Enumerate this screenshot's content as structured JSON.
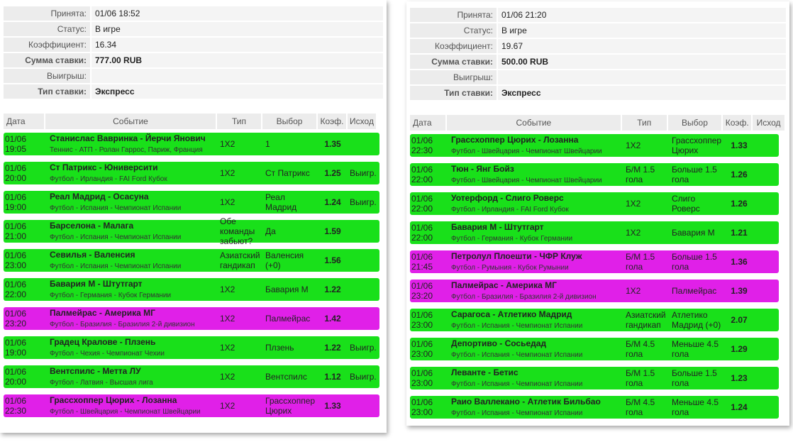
{
  "colors": {
    "win": "#19e01a",
    "loss": "#e020e8",
    "header_bg": "#ececec"
  },
  "columns": {
    "date": "Дата",
    "event": "Событие",
    "type": "Тип",
    "choice": "Выбор",
    "coef": "Коэф.",
    "result": "Исход"
  },
  "info_labels": {
    "accepted": "Принята:",
    "status": "Статус:",
    "coef": "Коэффициент:",
    "stake": "Сумма ставки:",
    "win": "Выигрыш:",
    "bet_type": "Тип ставки:"
  },
  "left": {
    "info": {
      "accepted": "01/06 18:52",
      "status": "В игре",
      "coef": "16.34",
      "stake": "777.00 RUB",
      "win": "",
      "bet_type": "Экспресс"
    },
    "rows": [
      {
        "date": "01/06",
        "time": "19:05",
        "event": "Станислас Вавринка - Йерчи Янович",
        "sub": "Теннис - АТП - Ролан Гаррос, Париж, Франция",
        "type": "1X2",
        "choice": "1",
        "coef": "1.35",
        "result": "",
        "state": "win"
      },
      {
        "date": "01/06",
        "time": "20:00",
        "event": "Ст Патрикс - Юниверсити",
        "sub": "Футбол - Ирландия - FAI Ford Кубок",
        "type": "1X2",
        "choice": "Ст Патрикс",
        "coef": "1.25",
        "result": "Выигр.",
        "state": "win"
      },
      {
        "date": "01/06",
        "time": "19:00",
        "event": "Реал Мадрид - Осасуна",
        "sub": "Футбол - Испания - Чемпионат Испании",
        "type": "1X2",
        "choice": "Реал Мадрид",
        "coef": "1.24",
        "result": "Выигр.",
        "state": "win"
      },
      {
        "date": "01/06",
        "time": "21:00",
        "event": "Барселона - Малага",
        "sub": "Футбол - Испания - Чемпионат Испании",
        "type": "Обе команды забьют?",
        "choice": "Да",
        "coef": "1.59",
        "result": "",
        "state": "win"
      },
      {
        "date": "01/06",
        "time": "23:00",
        "event": "Севилья - Валенсия",
        "sub": "Футбол - Испания - Чемпионат Испании",
        "type": "Азиатский гандикап",
        "choice": "Валенсия (+0)",
        "coef": "1.56",
        "result": "",
        "state": "win"
      },
      {
        "date": "01/06",
        "time": "22:00",
        "event": "Бавария М - Штутгарт",
        "sub": "Футбол - Германия - Кубок Германии",
        "type": "1X2",
        "choice": "Бавария М",
        "coef": "1.22",
        "result": "",
        "state": "win"
      },
      {
        "date": "01/06",
        "time": "23:20",
        "event": "Палмейрас - Америка МГ",
        "sub": "Футбол - Бразилия - Бразилия 2-й дивизион",
        "type": "1X2",
        "choice": "Палмейрас",
        "coef": "1.42",
        "result": "",
        "state": "loss"
      },
      {
        "date": "01/06",
        "time": "19:00",
        "event": "Градец Кралове - Плзень",
        "sub": "Футбол - Чехия - Чемпионат Чехии",
        "type": "1X2",
        "choice": "Плзень",
        "coef": "1.22",
        "result": "Выигр.",
        "state": "win"
      },
      {
        "date": "01/06",
        "time": "20:00",
        "event": "Вентспилс - Метта ЛУ",
        "sub": "Футбол - Латвия - Высшая лига",
        "type": "1X2",
        "choice": "Вентспилс",
        "coef": "1.12",
        "result": "Выигр.",
        "state": "win"
      },
      {
        "date": "01/06",
        "time": "22:30",
        "event": "Грассхоппер Цюрих - Лозанна",
        "sub": "Футбол - Швейцария - Чемпионат Швейцарии",
        "type": "1X2",
        "choice": "Грассхоппер Цюрих",
        "coef": "1.33",
        "result": "",
        "state": "loss"
      }
    ]
  },
  "right": {
    "info": {
      "accepted": "01/06 21:20",
      "status": "В игре",
      "coef": "19.67",
      "stake": "500.00 RUB",
      "win": "",
      "bet_type": "Экспресс"
    },
    "rows": [
      {
        "date": "01/06",
        "time": "22:30",
        "event": "Грассхоппер Цюрих - Лозанна",
        "sub": "Футбол - Швейцария - Чемпионат Швейцарии",
        "type": "1X2",
        "choice": "Грассхоппер Цюрих",
        "coef": "1.33",
        "result": "",
        "state": "win"
      },
      {
        "date": "01/06",
        "time": "22:00",
        "event": "Тюн - Янг Бойз",
        "sub": "Футбол - Швейцария - Чемпионат Швейцарии",
        "type": "Б/М 1.5 гола",
        "choice": "Больше 1.5 гола",
        "coef": "1.26",
        "result": "",
        "state": "win"
      },
      {
        "date": "01/06",
        "time": "22:00",
        "event": "Уотерфорд - Слиго Роверс",
        "sub": "Футбол - Ирландия - FAI Ford Кубок",
        "type": "1X2",
        "choice": "Слиго Роверс",
        "coef": "1.26",
        "result": "",
        "state": "win"
      },
      {
        "date": "01/06",
        "time": "22:00",
        "event": "Бавария М - Штутгарт",
        "sub": "Футбол - Германия - Кубок Германии",
        "type": "1X2",
        "choice": "Бавария М",
        "coef": "1.21",
        "result": "",
        "state": "win"
      },
      {
        "date": "01/06",
        "time": "21:45",
        "event": "Петролул Плоешти - ЧФР Клуж",
        "sub": "Футбол - Румыния - Кубок Румынии",
        "type": "Б/М 1.5 гола",
        "choice": "Больше 1.5 гола",
        "coef": "1.36",
        "result": "",
        "state": "loss"
      },
      {
        "date": "01/06",
        "time": "23:20",
        "event": "Палмейрас - Америка МГ",
        "sub": "Футбол - Бразилия - Бразилия 2-й дивизион",
        "type": "1X2",
        "choice": "Палмейрас",
        "coef": "1.39",
        "result": "",
        "state": "loss"
      },
      {
        "date": "01/06",
        "time": "23:00",
        "event": "Сарагоса - Атлетико Мадрид",
        "sub": "Футбол - Испания - Чемпионат Испании",
        "type": "Азиатский гандикап",
        "choice": "Атлетико Мадрид (+0)",
        "coef": "2.07",
        "result": "",
        "state": "win"
      },
      {
        "date": "01/06",
        "time": "23:00",
        "event": "Депортиво - Сосьедад",
        "sub": "Футбол - Испания - Чемпионат Испании",
        "type": "Б/М 4.5 гола",
        "choice": "Меньше 4.5 гола",
        "coef": "1.29",
        "result": "",
        "state": "win"
      },
      {
        "date": "01/06",
        "time": "23:00",
        "event": "Леванте - Бетис",
        "sub": "Футбол - Испания - Чемпионат Испании",
        "type": "Б/М 1.5 гола",
        "choice": "Больше 1.5 гола",
        "coef": "1.23",
        "result": "",
        "state": "win"
      },
      {
        "date": "01/06",
        "time": "23:00",
        "event": "Раио Валлекано - Атлетик Бильбао",
        "sub": "Футбол - Испания - Чемпионат Испании",
        "type": "Б/М 4.5 гола",
        "choice": "Меньше 4.5 гола",
        "coef": "1.24",
        "result": "",
        "state": "win"
      }
    ]
  }
}
